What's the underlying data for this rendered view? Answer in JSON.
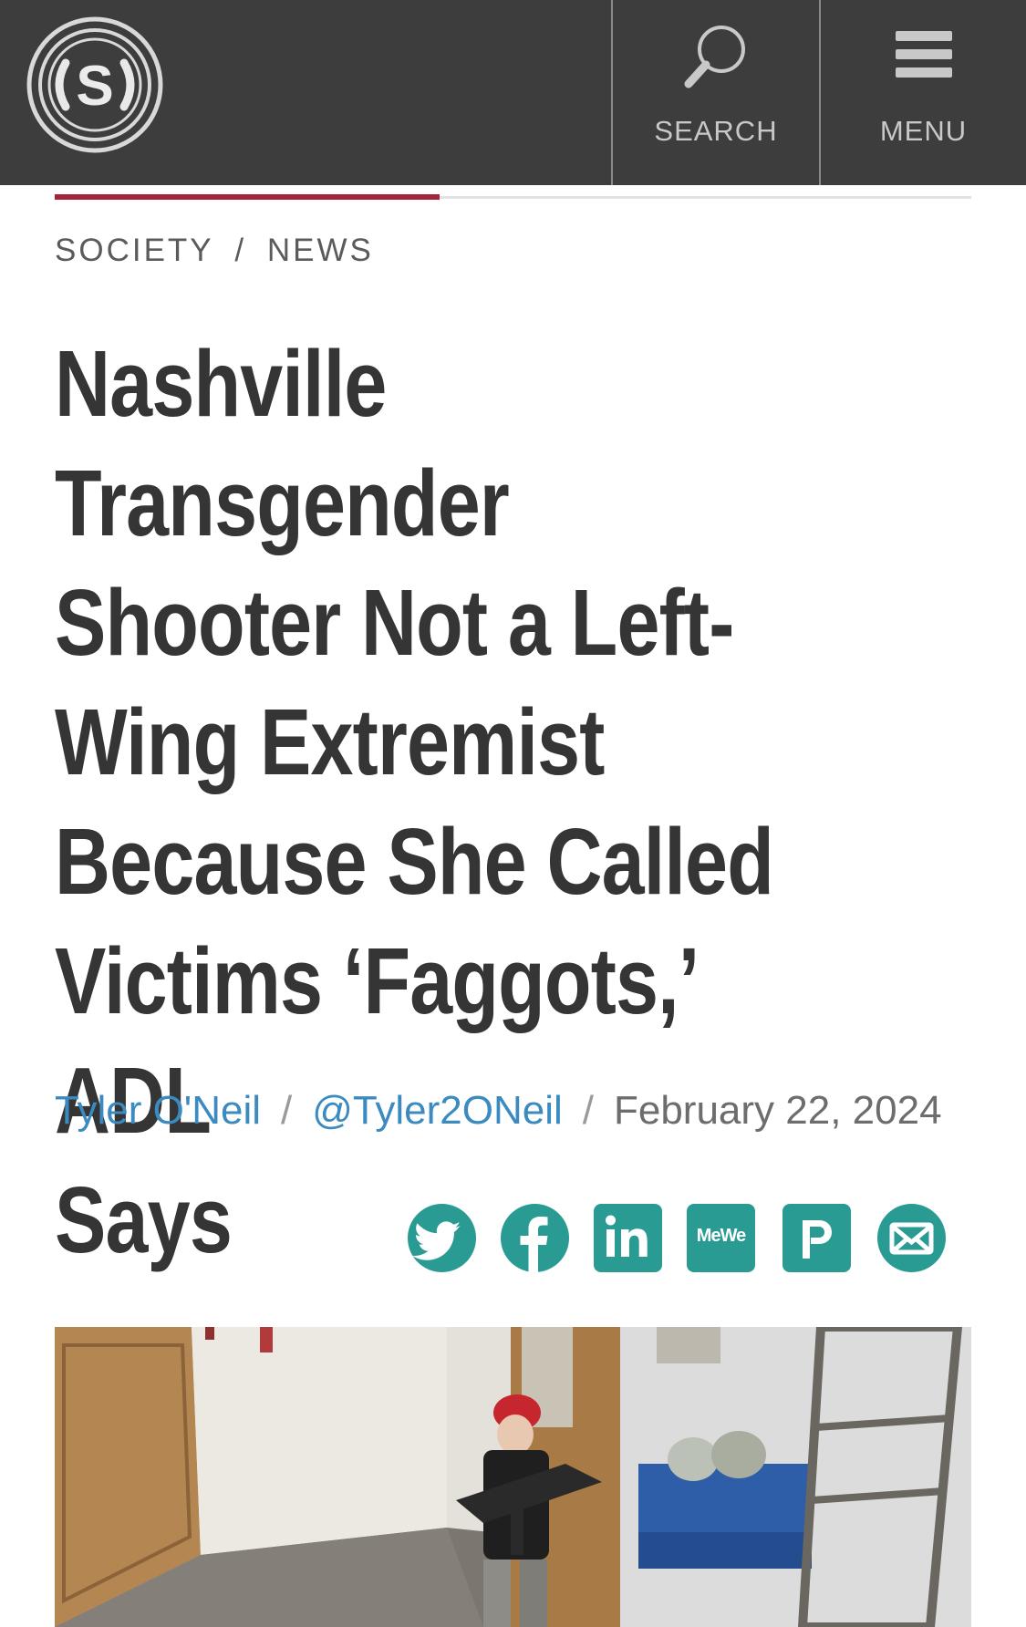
{
  "header": {
    "logo_letter": "S",
    "search_label": "SEARCH",
    "menu_label": "MENU"
  },
  "article": {
    "read_progress": 0.42,
    "category": "SOCIETY",
    "subcategory": "NEWS",
    "breadcrumb_sep": "/",
    "headline_lines": [
      "Nashville Transgender",
      "Shooter Not a Left-",
      "Wing Extremist",
      "Because She Called",
      "Victims ‘Faggots,’ ADL",
      "Says"
    ],
    "author": "Tyler O'Neil",
    "handle": "@Tyler2ONeil",
    "date": "February 22, 2024",
    "byline_sep": "/"
  },
  "share": {
    "color": "#2a9b93",
    "icons": [
      "twitter-icon",
      "facebook-icon",
      "linkedin-icon",
      "mewe-icon",
      "parler-icon",
      "email-icon"
    ],
    "mewe_text": "MeWe"
  },
  "colors": {
    "header_bg": "#3d3d3d",
    "accent": "#a4243b",
    "link": "#3b8bc1",
    "headline": "#353535"
  }
}
